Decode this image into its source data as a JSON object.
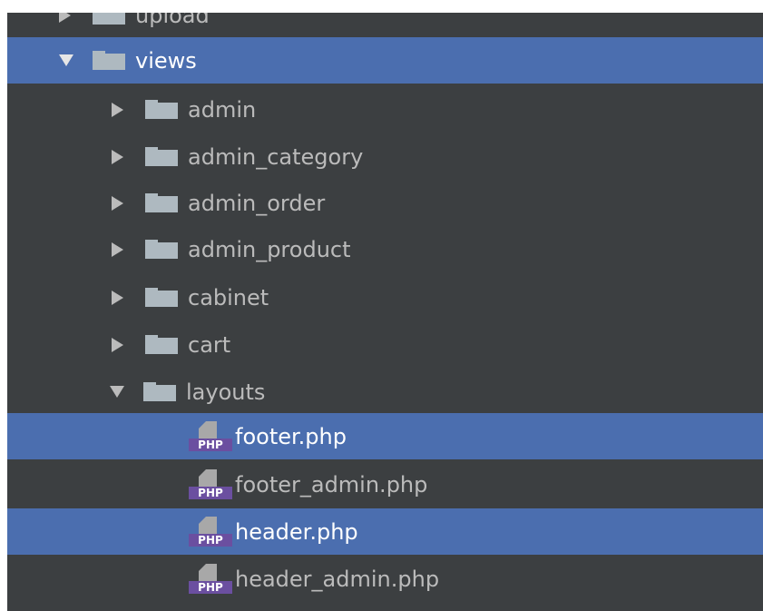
{
  "tree": {
    "items": [
      {
        "label": "upload",
        "type": "folder",
        "expanded": false,
        "selected": false
      },
      {
        "label": "views",
        "type": "folder",
        "expanded": true,
        "selected": true
      },
      {
        "label": "admin",
        "type": "folder",
        "expanded": false,
        "selected": false
      },
      {
        "label": "admin_category",
        "type": "folder",
        "expanded": false,
        "selected": false
      },
      {
        "label": "admin_order",
        "type": "folder",
        "expanded": false,
        "selected": false
      },
      {
        "label": "admin_product",
        "type": "folder",
        "expanded": false,
        "selected": false
      },
      {
        "label": "cabinet",
        "type": "folder",
        "expanded": false,
        "selected": false
      },
      {
        "label": "cart",
        "type": "folder",
        "expanded": false,
        "selected": false
      },
      {
        "label": "layouts",
        "type": "folder",
        "expanded": true,
        "selected": false
      },
      {
        "label": "footer.php",
        "type": "php-file",
        "selected": true
      },
      {
        "label": "footer_admin.php",
        "type": "php-file",
        "selected": false
      },
      {
        "label": "header.php",
        "type": "php-file",
        "selected": true
      },
      {
        "label": "header_admin.php",
        "type": "php-file",
        "selected": false
      }
    ],
    "php_badge": "PHP"
  },
  "colors": {
    "background": "#3c3f41",
    "selection": "#4b6eaf",
    "text": "#bbbbbb",
    "folder_icon": "#aeb9c0",
    "php_badge": "#6b4fa0"
  }
}
